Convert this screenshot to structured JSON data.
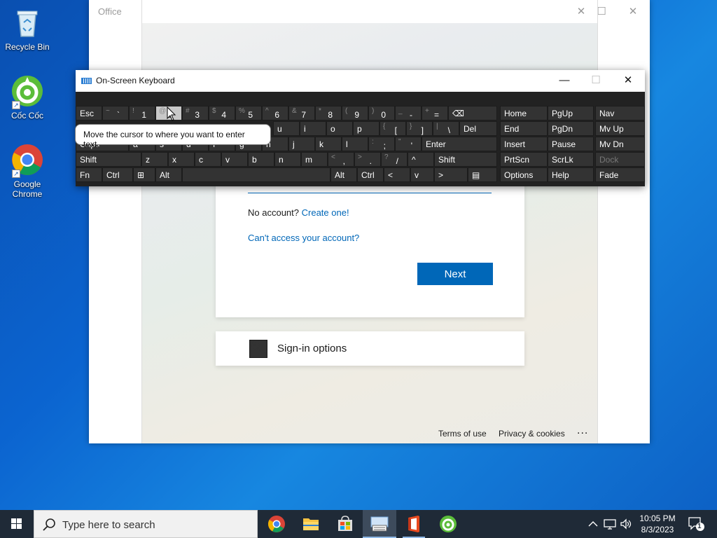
{
  "desktop": {
    "icons": [
      {
        "label": "Recycle Bin"
      },
      {
        "label": "Cốc Cốc"
      },
      {
        "label": "Google Chrome"
      }
    ]
  },
  "office_window": {
    "title": "Office",
    "controls": {
      "minimize": "—",
      "maximize": "☐",
      "close": "✕"
    },
    "signin": {
      "no_account_text": "No account?",
      "create_link": "Create one!",
      "cant_access": "Can't access your account?",
      "next_button": "Next",
      "signin_options": "Sign-in options"
    },
    "footer": {
      "terms": "Terms of use",
      "privacy": "Privacy & cookies",
      "more": "..."
    }
  },
  "osk": {
    "title": "On-Screen Keyboard",
    "tooltip": "Move the cursor to where you want to enter text.",
    "row1": [
      {
        "main": "Esc"
      },
      {
        "shift": "~",
        "primary": "`"
      },
      {
        "shift": "!",
        "primary": "1"
      },
      {
        "shift": "@",
        "primary": "2"
      },
      {
        "shift": "#",
        "primary": "3"
      },
      {
        "shift": "$",
        "primary": "4"
      },
      {
        "shift": "%",
        "primary": "5"
      },
      {
        "shift": "^",
        "primary": "6"
      },
      {
        "shift": "&",
        "primary": "7"
      },
      {
        "shift": "*",
        "primary": "8"
      },
      {
        "shift": "(",
        "primary": "9"
      },
      {
        "shift": ")",
        "primary": "0"
      },
      {
        "shift": "_",
        "primary": "-"
      },
      {
        "shift": "+",
        "primary": "="
      },
      {
        "main": "⌫"
      }
    ],
    "row2": [
      {
        "main": "u"
      },
      {
        "main": "i"
      },
      {
        "main": "o"
      },
      {
        "main": "p"
      },
      {
        "shift": "{",
        "primary": "["
      },
      {
        "shift": "}",
        "primary": "]"
      },
      {
        "shift": "|",
        "primary": "\\"
      },
      {
        "main": "Del"
      }
    ],
    "row3": [
      {
        "main": "Caps"
      },
      {
        "main": "a"
      },
      {
        "main": "s"
      },
      {
        "main": "d"
      },
      {
        "main": "f"
      },
      {
        "main": "g"
      },
      {
        "main": "h"
      },
      {
        "main": "j"
      },
      {
        "main": "k"
      },
      {
        "main": "l"
      },
      {
        "shift": ":",
        "primary": ";"
      },
      {
        "shift": "\"",
        "primary": "'"
      },
      {
        "main": "Enter"
      }
    ],
    "row4": [
      {
        "main": "Shift"
      },
      {
        "main": "z"
      },
      {
        "main": "x"
      },
      {
        "main": "c"
      },
      {
        "main": "v"
      },
      {
        "main": "b"
      },
      {
        "main": "n"
      },
      {
        "main": "m"
      },
      {
        "shift": "<",
        "primary": ","
      },
      {
        "shift": ">",
        "primary": "."
      },
      {
        "shift": "?",
        "primary": "/"
      },
      {
        "main": "^"
      },
      {
        "main": "Shift"
      }
    ],
    "row5": [
      {
        "main": "Fn"
      },
      {
        "main": "Ctrl"
      },
      {
        "main": "⊞"
      },
      {
        "main": "Alt"
      },
      {
        "main": ""
      },
      {
        "main": "Alt"
      },
      {
        "main": "Ctrl"
      },
      {
        "main": "<"
      },
      {
        "main": "v"
      },
      {
        "main": ">"
      },
      {
        "main": "▤"
      }
    ],
    "nav_col1": [
      "Home",
      "End",
      "Insert",
      "PrtScn",
      "Options"
    ],
    "nav_col2": [
      "PgUp",
      "PgDn",
      "Pause",
      "ScrLk",
      "Help"
    ],
    "nav_col3": [
      "Nav",
      "Mv Up",
      "Mv Dn",
      "Dock",
      "Fade"
    ]
  },
  "taskbar": {
    "search_placeholder": "Type here to search",
    "time": "10:05 PM",
    "date": "8/3/2023",
    "notification_count": "1"
  }
}
